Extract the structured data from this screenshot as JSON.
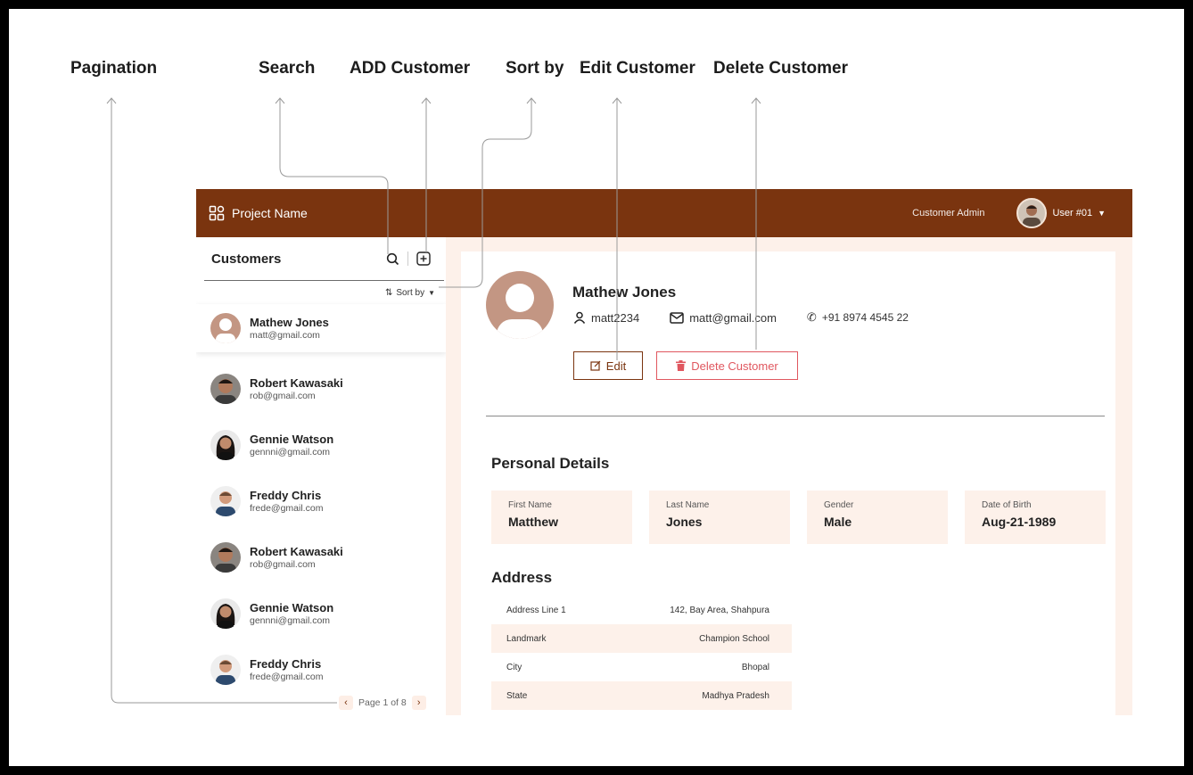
{
  "annotations": {
    "pagination": "Pagination",
    "search": "Search",
    "add_customer": "ADD Customer",
    "sort_by": "Sort by",
    "edit_customer": "Edit Customer",
    "delete_customer": "Delete Customer"
  },
  "header": {
    "project_name": "Project Name",
    "role": "Customer Admin",
    "user": "User #01"
  },
  "sidebar": {
    "title": "Customers",
    "sort_label": "Sort by",
    "customers": [
      {
        "name": "Mathew Jones",
        "email": "matt@gmail.com"
      },
      {
        "name": "Robert Kawasaki",
        "email": "rob@gmail.com"
      },
      {
        "name": "Gennie Watson",
        "email": "gennni@gmail.com"
      },
      {
        "name": "Freddy Chris",
        "email": "frede@gmail.com"
      },
      {
        "name": "Robert Kawasaki",
        "email": "rob@gmail.com"
      },
      {
        "name": "Gennie Watson",
        "email": "gennni@gmail.com"
      },
      {
        "name": "Freddy Chris",
        "email": "frede@gmail.com"
      }
    ],
    "pagination": "Page 1 of 8"
  },
  "profile": {
    "name": "Mathew Jones",
    "username": "matt2234",
    "email": "matt@gmail.com",
    "phone": "+91 8974 4545 22",
    "edit_label": "Edit",
    "delete_label": "Delete Customer"
  },
  "personal": {
    "title": "Personal Details",
    "fields": [
      {
        "label": "First Name",
        "value": "Matthew"
      },
      {
        "label": "Last Name",
        "value": "Jones"
      },
      {
        "label": "Gender",
        "value": "Male"
      },
      {
        "label": "Date of Birth",
        "value": "Aug-21-1989"
      }
    ]
  },
  "address": {
    "title": "Address",
    "rows": [
      {
        "label": "Address Line 1",
        "value": "142, Bay Area, Shahpura"
      },
      {
        "label": "Landmark",
        "value": "Champion School"
      },
      {
        "label": "City",
        "value": "Bhopal"
      },
      {
        "label": "State",
        "value": "Madhya Pradesh"
      }
    ]
  },
  "colors": {
    "brand": "#7a340f",
    "accent_bg": "#fdf1ea",
    "danger": "#e0575f"
  }
}
